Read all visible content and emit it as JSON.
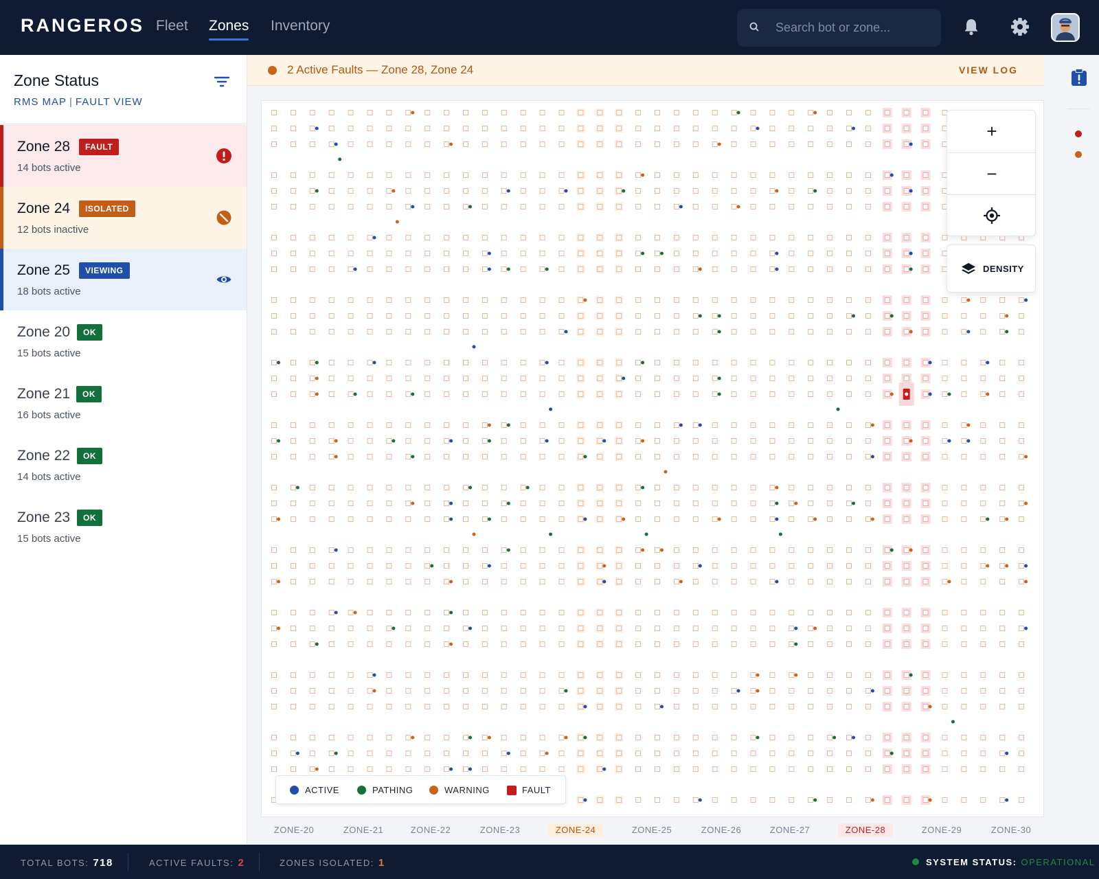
{
  "colors": {
    "active": "#1f4fa8",
    "pathing": "#17703a",
    "warning": "#c8651c",
    "fault": "#c01d1d",
    "isolated": "#c45d16",
    "viewing": "#1f4fa8",
    "ok": "#12703a"
  },
  "header": {
    "brand": "RANGEROS",
    "nav": [
      {
        "label": "Fleet",
        "active": false
      },
      {
        "label": "Zones",
        "active": true
      },
      {
        "label": "Inventory",
        "active": false
      }
    ],
    "search": {
      "placeholder": "Search bot or zone...",
      "value": ""
    },
    "icons": [
      "search-icon",
      "bell-icon",
      "gear-icon",
      "avatar"
    ]
  },
  "sidebar": {
    "title": "Zone Status",
    "subtitle_left": "RMS MAP",
    "subtitle_sep": "|",
    "subtitle_right": "FAULT VIEW",
    "zones": [
      {
        "name": "Zone 28",
        "badge": "FAULT",
        "meta": "14 bots active",
        "state": "fault",
        "icon": "alert-icon"
      },
      {
        "name": "Zone 24",
        "badge": "ISOLATED",
        "meta": "12 bots inactive",
        "state": "isolated",
        "icon": "blocked-icon"
      },
      {
        "name": "Zone 25",
        "badge": "VIEWING",
        "meta": "18 bots active",
        "state": "viewing",
        "icon": "eye-icon"
      },
      {
        "name": "Zone 20",
        "badge": "OK",
        "meta": "15 bots active",
        "state": "ok",
        "icon": ""
      },
      {
        "name": "Zone 21",
        "badge": "OK",
        "meta": "16 bots active",
        "state": "ok",
        "icon": ""
      },
      {
        "name": "Zone 22",
        "badge": "OK",
        "meta": "14 bots active",
        "state": "ok",
        "icon": ""
      },
      {
        "name": "Zone 23",
        "badge": "OK",
        "meta": "15 bots active",
        "state": "ok",
        "icon": ""
      }
    ]
  },
  "alert": {
    "text": "2 Active Faults — Zone 28, Zone 24",
    "action": "VIEW LOG"
  },
  "map": {
    "controls": {
      "zoom_in": "+",
      "zoom_out": "−",
      "locate_icon": "crosshair-icon"
    },
    "density_label": "DENSITY",
    "legend": [
      {
        "label": "ACTIVE",
        "key": "active"
      },
      {
        "label": "PATHING",
        "key": "pathing"
      },
      {
        "label": "WARNING",
        "key": "warning"
      },
      {
        "label": "FAULT",
        "key": "fault"
      }
    ],
    "zone_labels": [
      "ZONE-20",
      "ZONE-21",
      "ZONE-22",
      "ZONE-23",
      "ZONE-24",
      "ZONE-25",
      "ZONE-26",
      "ZONE-27",
      "ZONE-28",
      "ZONE-29",
      "ZONE-30"
    ],
    "highlighted_zones": {
      "ZONE-24": "warning",
      "ZONE-28": "fault"
    }
  },
  "statusbar": {
    "total_bots_label": "TOTAL BOTS:",
    "total_bots": "718",
    "active_faults_label": "ACTIVE FAULTS:",
    "active_faults": "2",
    "zones_isolated_label": "ZONES ISOLATED:",
    "zones_isolated": "1",
    "system_status_label": "SYSTEM STATUS:",
    "system_status": "OPERATIONAL"
  }
}
